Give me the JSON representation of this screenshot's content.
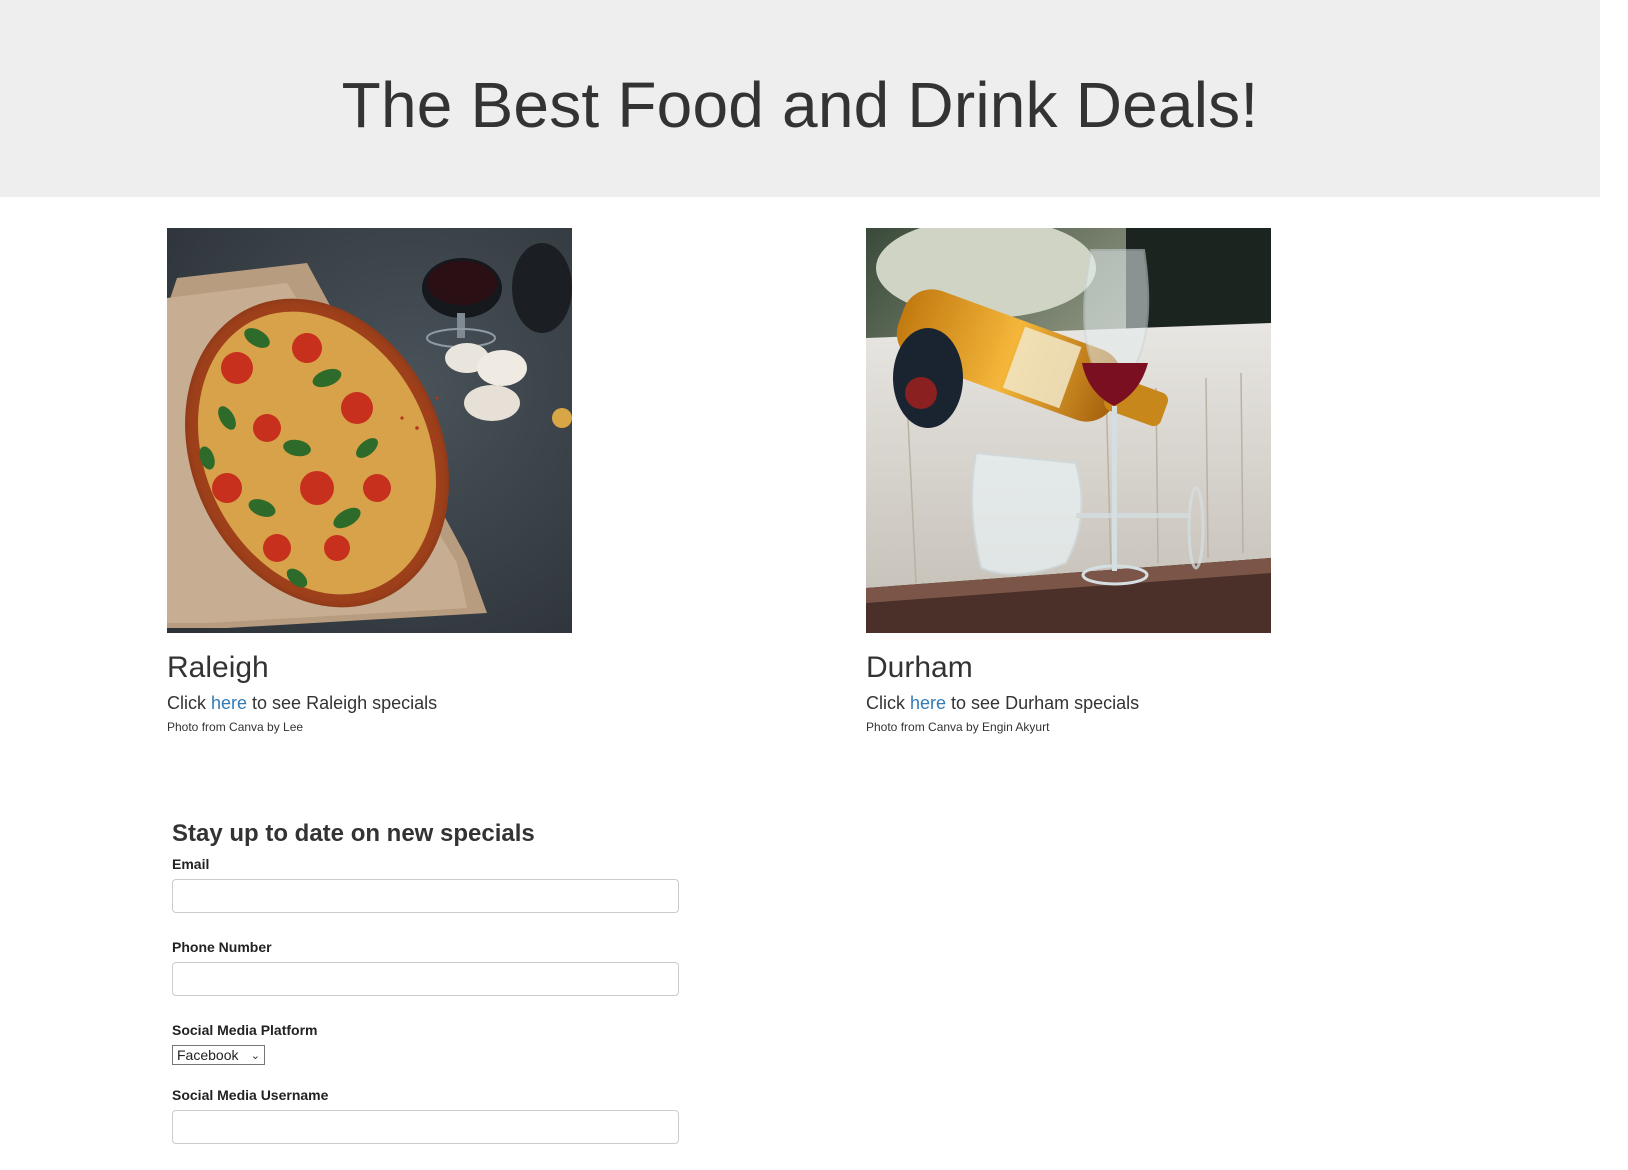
{
  "header": {
    "title": "The Best Food and Drink Deals!"
  },
  "cities": [
    {
      "name": "Raleigh",
      "image_subject": "pizza-photo",
      "link_prefix": "Click ",
      "link_text": "here",
      "link_suffix": " to see Raleigh specials",
      "credit": "Photo from Canva by Lee"
    },
    {
      "name": "Durham",
      "image_subject": "wine-photo",
      "link_prefix": "Click ",
      "link_text": "here",
      "link_suffix": " to see Durham specials",
      "credit": "Photo from Canva by Engin Akyurt"
    }
  ],
  "signup": {
    "heading": "Stay up to date on new specials",
    "email_label": "Email",
    "email_value": "",
    "phone_label": "Phone Number",
    "phone_value": "",
    "platform_label": "Social Media Platform",
    "platform_selected": "Facebook",
    "username_label": "Social Media Username",
    "username_value": ""
  },
  "colors": {
    "hero_bg": "#eeeeee",
    "text": "#333333",
    "link": "#337ab7"
  }
}
